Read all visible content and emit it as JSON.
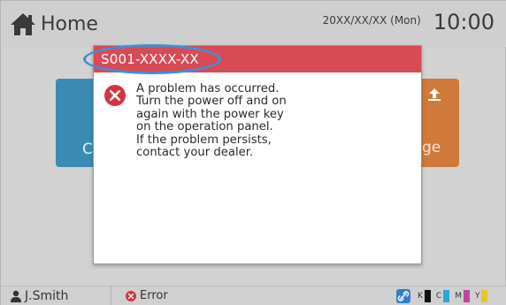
{
  "header": {
    "home_label": "Home",
    "date": "20XX/XX/XX (Mon)",
    "time": "10:00"
  },
  "background_tiles": {
    "left_label": "C",
    "right_label": "ge"
  },
  "dialog": {
    "error_code": "S001-XXXX-XX",
    "message": "A problem has occurred.\nTurn the power off and on\nagain with the power key\non the operation panel.\nIf the problem persists,\ncontact your dealer.",
    "title_color": "#d84a55",
    "highlight_color": "#3f8fd6"
  },
  "statusbar": {
    "user_name": "J.Smith",
    "status_text": "Error",
    "inks": [
      {
        "label": "K",
        "color": "#111111"
      },
      {
        "label": "C",
        "color": "#2ba6d9"
      },
      {
        "label": "M",
        "color": "#c2449c"
      },
      {
        "label": "Y",
        "color": "#e6c628"
      }
    ]
  }
}
